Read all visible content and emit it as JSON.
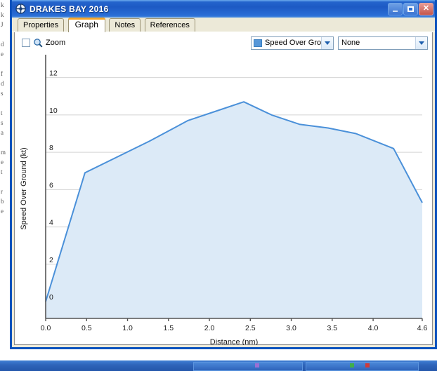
{
  "window": {
    "title": "DRAKES BAY 2016",
    "icon": "target-crosshair-icon",
    "controls": {
      "minimize": "Minimize",
      "maximize": "Maximize",
      "close": "Close"
    }
  },
  "tabs": [
    {
      "label": "Properties",
      "active": false
    },
    {
      "label": "Graph",
      "active": true
    },
    {
      "label": "Notes",
      "active": false
    },
    {
      "label": "References",
      "active": false
    }
  ],
  "toolbar": {
    "zoom_checkbox_checked": false,
    "zoom_label": "Zoom",
    "zoom_icon": "magnifier-icon",
    "series_select": {
      "value": "Speed Over Grou",
      "swatch_color": "#5596d8"
    },
    "overlay_select": {
      "value": "None"
    }
  },
  "chart_data": {
    "type": "area",
    "title": "",
    "xlabel": "Distance  (nm)",
    "ylabel": "Speed Over Ground (kt)",
    "xlim": [
      0.0,
      4.6
    ],
    "ylim": [
      -0.9,
      13.0
    ],
    "grid": true,
    "legend": "none",
    "line_color": "#4a90d9",
    "fill_color": "#dceaf7",
    "xticks": [
      "0.0",
      "0.5",
      "1.0",
      "1.5",
      "2.0",
      "2.5",
      "3.0",
      "3.5",
      "4.0",
      "4.6"
    ],
    "xtick_values": [
      0.0,
      0.5,
      1.0,
      1.5,
      2.0,
      2.5,
      3.0,
      3.5,
      4.0,
      4.6
    ],
    "yticks": [
      "0",
      "2",
      "4",
      "6",
      "8",
      "10",
      "12"
    ],
    "ytick_values": [
      0,
      2,
      4,
      6,
      8,
      10,
      12
    ],
    "series": [
      {
        "name": "Speed Over Ground",
        "x": [
          0.0,
          0.48,
          1.27,
          1.74,
          2.08,
          2.42,
          2.76,
          3.1,
          3.45,
          3.79,
          4.25,
          4.6
        ],
        "values": [
          0.0,
          6.9,
          8.6,
          9.7,
          10.2,
          10.7,
          10.0,
          9.5,
          9.3,
          9.0,
          8.2,
          5.3
        ]
      }
    ]
  },
  "desktop": {
    "side_text": "k\nk\nJ\n \nd\ne\n \nf\nd\ns\n \nt\ns\na\n \nm\ne\nt\n \nr\nb\ne",
    "taskbar_items": [
      {
        "label": "",
        "left": 275,
        "width": 150
      },
      {
        "label": "",
        "left": 435,
        "width": 155
      }
    ]
  }
}
